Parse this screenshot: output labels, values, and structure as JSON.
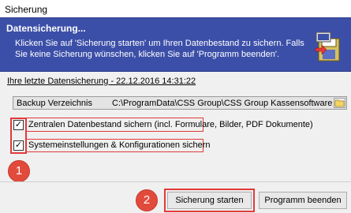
{
  "window": {
    "title": "Sicherung"
  },
  "banner": {
    "title": "Datensicherung...",
    "text": "Klicken Sie auf 'Sicherung starten' um Ihren Datenbestand zu sichern. Falls Sie keine Sicherung wünschen, klicken Sie auf 'Programm beenden'.",
    "icon": "backup-disk-icon",
    "color": "#3c4fa8"
  },
  "last_backup": {
    "text": "Ihre letzte Datensicherung - 22.12.2016 14:31:22"
  },
  "backup_dir": {
    "label": "Backup Verzeichnis",
    "value": "C:\\ProgramData\\CSS Group\\CSS Group Kassensoftware",
    "button_icon": "folder-icon"
  },
  "options": [
    {
      "label": "Zentralen Datenbestand sichern (incl. Formulare, Bilder, PDF Dokumente)",
      "checked": true
    },
    {
      "label": "Systemeinstellungen & Konfigurationen sichern",
      "checked": true
    }
  ],
  "annotations": {
    "badge1": "1",
    "badge2": "2",
    "color": "#e24b3c"
  },
  "buttons": {
    "start": "Sicherung starten",
    "exit": "Programm beenden"
  }
}
